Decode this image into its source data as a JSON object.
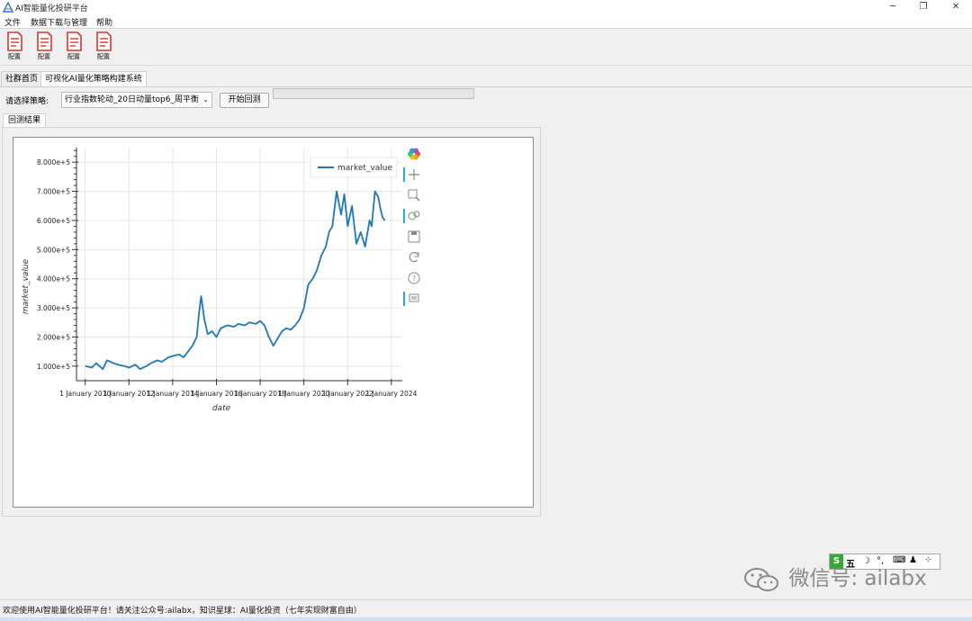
{
  "window": {
    "title": "AI智能量化投研平台",
    "controls": [
      "─",
      "❐",
      "✕"
    ]
  },
  "menu": {
    "items": [
      "文件",
      "数据下载与管理",
      "帮助"
    ]
  },
  "toolbar": {
    "buttons": [
      {
        "label": "配置",
        "icon": "document-icon"
      },
      {
        "label": "配置",
        "icon": "document-icon"
      },
      {
        "label": "配置",
        "icon": "document-icon"
      },
      {
        "label": "配置",
        "icon": "document-icon"
      }
    ]
  },
  "tabs": [
    "社群首页",
    "可视化AI量化策略构建系统"
  ],
  "strategy": {
    "label": "请选择策略:",
    "selected": "行业指数轮动_20日动量top6_周平衡",
    "run_button": "开始回测",
    "progress": 0
  },
  "subtab": "回测结果",
  "chart_toolbar": {
    "icons": [
      "bokeh-logo-icon",
      "pan-icon",
      "box-zoom-icon",
      "wheel-zoom-icon",
      "save-icon",
      "reset-icon",
      "help-icon",
      "hover-icon"
    ]
  },
  "chart_data": {
    "type": "line",
    "xlabel": "date",
    "ylabel": "market_value",
    "ylim": [
      50000,
      850000
    ],
    "yticks": [
      100000,
      200000,
      300000,
      400000,
      500000,
      600000,
      700000,
      800000
    ],
    "ytick_labels": [
      "1.000e+5",
      "2.000e+5",
      "3.000e+5",
      "4.000e+5",
      "5.000e+5",
      "6.000e+5",
      "7.000e+5",
      "8.000e+5"
    ],
    "xlim": [
      2009.6,
      2024.5
    ],
    "xticks": [
      2010,
      2012,
      2014,
      2016,
      2018,
      2020,
      2022,
      2024
    ],
    "xtick_labels": [
      "1 January 2010",
      "1 January 2012",
      "1 January 2014",
      "1 January 2016",
      "1 January 2018",
      "1 January 2020",
      "1 January 2022",
      "1 January 2024"
    ],
    "legend": "top-right",
    "grid": true,
    "color": "#1f77b4",
    "series": [
      {
        "name": "market_value",
        "x": [
          2010.0,
          2010.3,
          2010.5,
          2010.8,
          2011.0,
          2011.3,
          2011.5,
          2011.8,
          2012.0,
          2012.3,
          2012.5,
          2012.8,
          2013.0,
          2013.3,
          2013.5,
          2013.8,
          2014.0,
          2014.3,
          2014.5,
          2014.7,
          2014.9,
          2015.1,
          2015.2,
          2015.3,
          2015.45,
          2015.6,
          2015.8,
          2016.0,
          2016.2,
          2016.5,
          2016.8,
          2017.0,
          2017.3,
          2017.5,
          2017.8,
          2018.0,
          2018.2,
          2018.4,
          2018.6,
          2018.8,
          2019.0,
          2019.2,
          2019.4,
          2019.6,
          2019.8,
          2020.0,
          2020.2,
          2020.4,
          2020.6,
          2020.8,
          2021.0,
          2021.15,
          2021.3,
          2021.5,
          2021.7,
          2021.85,
          2022.0,
          2022.2,
          2022.4,
          2022.6,
          2022.8,
          2023.0,
          2023.1,
          2023.25,
          2023.4,
          2023.5,
          2023.6,
          2023.7
        ],
        "y": [
          100000,
          95000,
          110000,
          90000,
          120000,
          110000,
          105000,
          100000,
          95000,
          105000,
          90000,
          100000,
          110000,
          120000,
          115000,
          130000,
          135000,
          140000,
          130000,
          150000,
          170000,
          200000,
          280000,
          340000,
          260000,
          210000,
          220000,
          200000,
          230000,
          240000,
          235000,
          245000,
          240000,
          250000,
          245000,
          255000,
          240000,
          200000,
          170000,
          195000,
          220000,
          230000,
          225000,
          240000,
          260000,
          300000,
          380000,
          400000,
          430000,
          480000,
          510000,
          560000,
          580000,
          700000,
          620000,
          690000,
          580000,
          650000,
          520000,
          560000,
          510000,
          600000,
          580000,
          700000,
          680000,
          640000,
          610000,
          600000
        ]
      }
    ]
  },
  "status": {
    "message": "欢迎使用AI智能量化投研平台！请关注公众号:ailabx，知识星球：AI量化投资（七年实现财富自由）"
  },
  "ime_bar": {
    "items": [
      "S",
      "五",
      "☽",
      "°,",
      "⌨",
      "♟",
      "⁘"
    ]
  },
  "watermark": {
    "text": "微信号: ailabx"
  }
}
